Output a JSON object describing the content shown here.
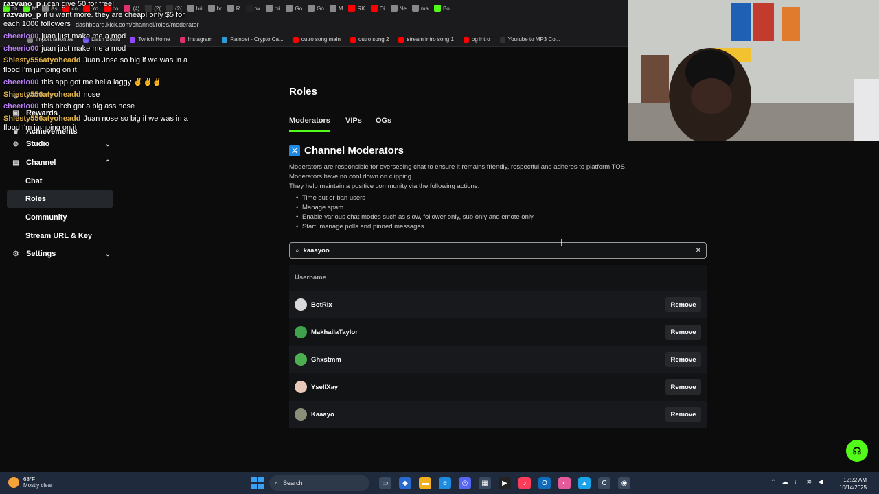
{
  "browser": {
    "tabs": [
      "ch",
      "M",
      "As",
      "co",
      "Yo",
      "co",
      "(4)",
      "(2(",
      "(2(",
      "bri",
      "br",
      "R",
      "tw",
      "pri",
      "Go",
      "Go",
      "M",
      "RK",
      "Oi",
      "Ne",
      "ma",
      "Bo"
    ],
    "url": "dashboard.kick.com/channel/roles/moderator",
    "bookmarks": [
      {
        "label": "Import favorites",
        "color": "#888888"
      },
      {
        "label": "Dash Board",
        "color": "#7b5cf5"
      },
      {
        "label": "Twitch Home",
        "color": "#9146ff"
      },
      {
        "label": "Instagram",
        "color": "#e1306c"
      },
      {
        "label": "Rainbet - Crypto Ca...",
        "color": "#2d9cdb"
      },
      {
        "label": "outro song main",
        "color": "#ff0000"
      },
      {
        "label": "outro song 2",
        "color": "#ff0000"
      },
      {
        "label": "stream intro song 1",
        "color": "#ff0000"
      },
      {
        "label": "og intro",
        "color": "#ff0000"
      },
      {
        "label": "Youtube to MP3 Co...",
        "color": "#333333"
      }
    ]
  },
  "chat": [
    {
      "user": "razvano_p",
      "msg": "i can give 50 for free!",
      "color": "#f0f0f0"
    },
    {
      "user": "razvano_p",
      "msg": "if u want more. they are cheap! only $5 for",
      "color": "#f0f0f0"
    },
    {
      "user": "",
      "msg": "each 1000 followers",
      "color": "#f0f0f0"
    },
    {
      "user": "cheerio00",
      "msg": "juan just make me a mod",
      "color": "#b67cf0"
    },
    {
      "user": "cheerio00",
      "msg": "juan just make me a mod",
      "color": "#b67cf0"
    },
    {
      "user": "Shiesty556atyoheadd",
      "msg": "Juan Jose so big if we was in a",
      "color": "#e0b24a"
    },
    {
      "user": "",
      "msg": "flood I'm jumping on it",
      "color": "#e0b24a"
    },
    {
      "user": "cheerio00",
      "msg": "this app got me hella laggy ✌✌✌",
      "color": "#b67cf0"
    },
    {
      "user": "Shiesty556atyoheadd",
      "msg": "nose",
      "color": "#e0b24a"
    },
    {
      "user": "cheerio00",
      "msg": "this bitch got a big ass nose",
      "color": "#b67cf0"
    },
    {
      "user": "Shiesty556atyoheadd",
      "msg": "Juan nose so big if we was in a",
      "color": "#e0b24a"
    },
    {
      "user": "",
      "msg": "flood I'm jumping on it",
      "color": "#e0b24a"
    }
  ],
  "sidebar": {
    "items": [
      {
        "label": "Stream",
        "icon": "broadcast-icon"
      },
      {
        "label": "Rewards",
        "icon": "gift-icon"
      },
      {
        "label": "Achievements",
        "icon": "trophy-icon"
      },
      {
        "label": "Studio",
        "icon": "studio-icon"
      },
      {
        "label": "Channel",
        "icon": "channel-icon"
      },
      {
        "label": "Chat",
        "icon": ""
      },
      {
        "label": "Roles",
        "icon": ""
      },
      {
        "label": "Community",
        "icon": ""
      },
      {
        "label": "Stream URL & Key",
        "icon": ""
      },
      {
        "label": "Settings",
        "icon": "gear-icon"
      }
    ]
  },
  "main": {
    "title": "Roles",
    "tabs": [
      "Moderators",
      "VIPs",
      "OGs"
    ],
    "section_title": "Channel Moderators",
    "description": [
      "Moderators are responsible for overseeing chat to ensure it remains friendly, respectful and adheres to platform TOS.",
      "Moderators have no cool down on clipping.",
      "They help maintain a positive community via the following actions:"
    ],
    "actions": [
      "Time out or ban users",
      "Manage spam",
      "Enable various chat modes such as slow, follower only, sub only and emote only",
      "Start, manage polls and pinned messages"
    ],
    "search": {
      "value": "kaaayoo",
      "placeholder": ""
    },
    "table": {
      "header": "Username",
      "remove_label": "Remove",
      "rows": [
        {
          "username": "BotRix",
          "avatar_color": "#d9d9d9"
        },
        {
          "username": "MakhailaTaylor",
          "avatar_color": "#3fa34d"
        },
        {
          "username": "Ghxstmm",
          "avatar_color": "#4caf50"
        },
        {
          "username": "YsellXay",
          "avatar_color": "#e8c8b8"
        },
        {
          "username": "Kaaayo",
          "avatar_color": "#8a8f7a"
        }
      ]
    }
  },
  "taskbar": {
    "weather_temp": "68°F",
    "weather_desc": "Mostly clear",
    "search_label": "Search",
    "time": "12:22 AM",
    "date": "10/14/2025"
  },
  "colors": {
    "accent": "#53fc18"
  }
}
